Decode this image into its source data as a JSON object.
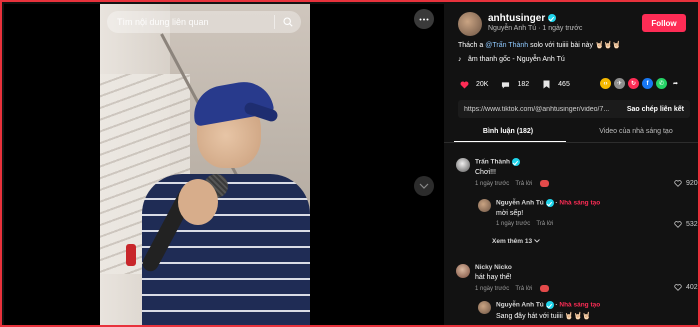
{
  "search": {
    "placeholder": "Tìm nội dung liên quan"
  },
  "post": {
    "username": "anhtusinger",
    "author_display": "Nguyễn Anh Tú",
    "time": "1 ngày trước",
    "follow_label": "Follow",
    "caption_prefix": "Thách a ",
    "caption_mention": "@Trấn Thành",
    "caption_suffix": " solo với tuiiii bài này 🤘🏻🤘🏻🤘🏻",
    "music": "âm thanh gốc - Nguyễn Anh Tú",
    "likes": "20K",
    "comments": "182",
    "saves": "465",
    "url": "https://www.tiktok.com/@anhtusinger/video/7...",
    "copy_label": "Sao chép liên kết"
  },
  "tabs": [
    {
      "label": "Bình luận (182)",
      "active": true
    },
    {
      "label": "Video của nhà sáng tạo",
      "active": false
    }
  ],
  "comments": [
    {
      "author": "Trấn Thành",
      "text": "Chơi!!!",
      "time": "1 ngày trước",
      "reply": "Trả lời",
      "likes": "920"
    },
    {
      "author": "Nguyễn Anh Tú",
      "creator_tag": "Nhà sáng tạo",
      "text": "mời sếp!",
      "time": "1 ngày trước",
      "reply": "Trả lời",
      "likes": "532"
    },
    {
      "author": "Nicky Nicko",
      "text": "hát hay thế!",
      "time": "1 ngày trước",
      "reply": "Trả lời",
      "likes": "402"
    },
    {
      "author": "Nguyễn Anh Tú",
      "creator_tag": "Nhà sáng tạo",
      "text": "Sang đây hát với tuiiii 🤘🏻🤘🏻🤘🏻"
    }
  ],
  "see_more": "Xem thêm 13",
  "colors": {
    "accent": "#fe2c55",
    "panel_bg": "#121212",
    "verified": "#20d5ec",
    "frame_border": "#e8323c"
  }
}
